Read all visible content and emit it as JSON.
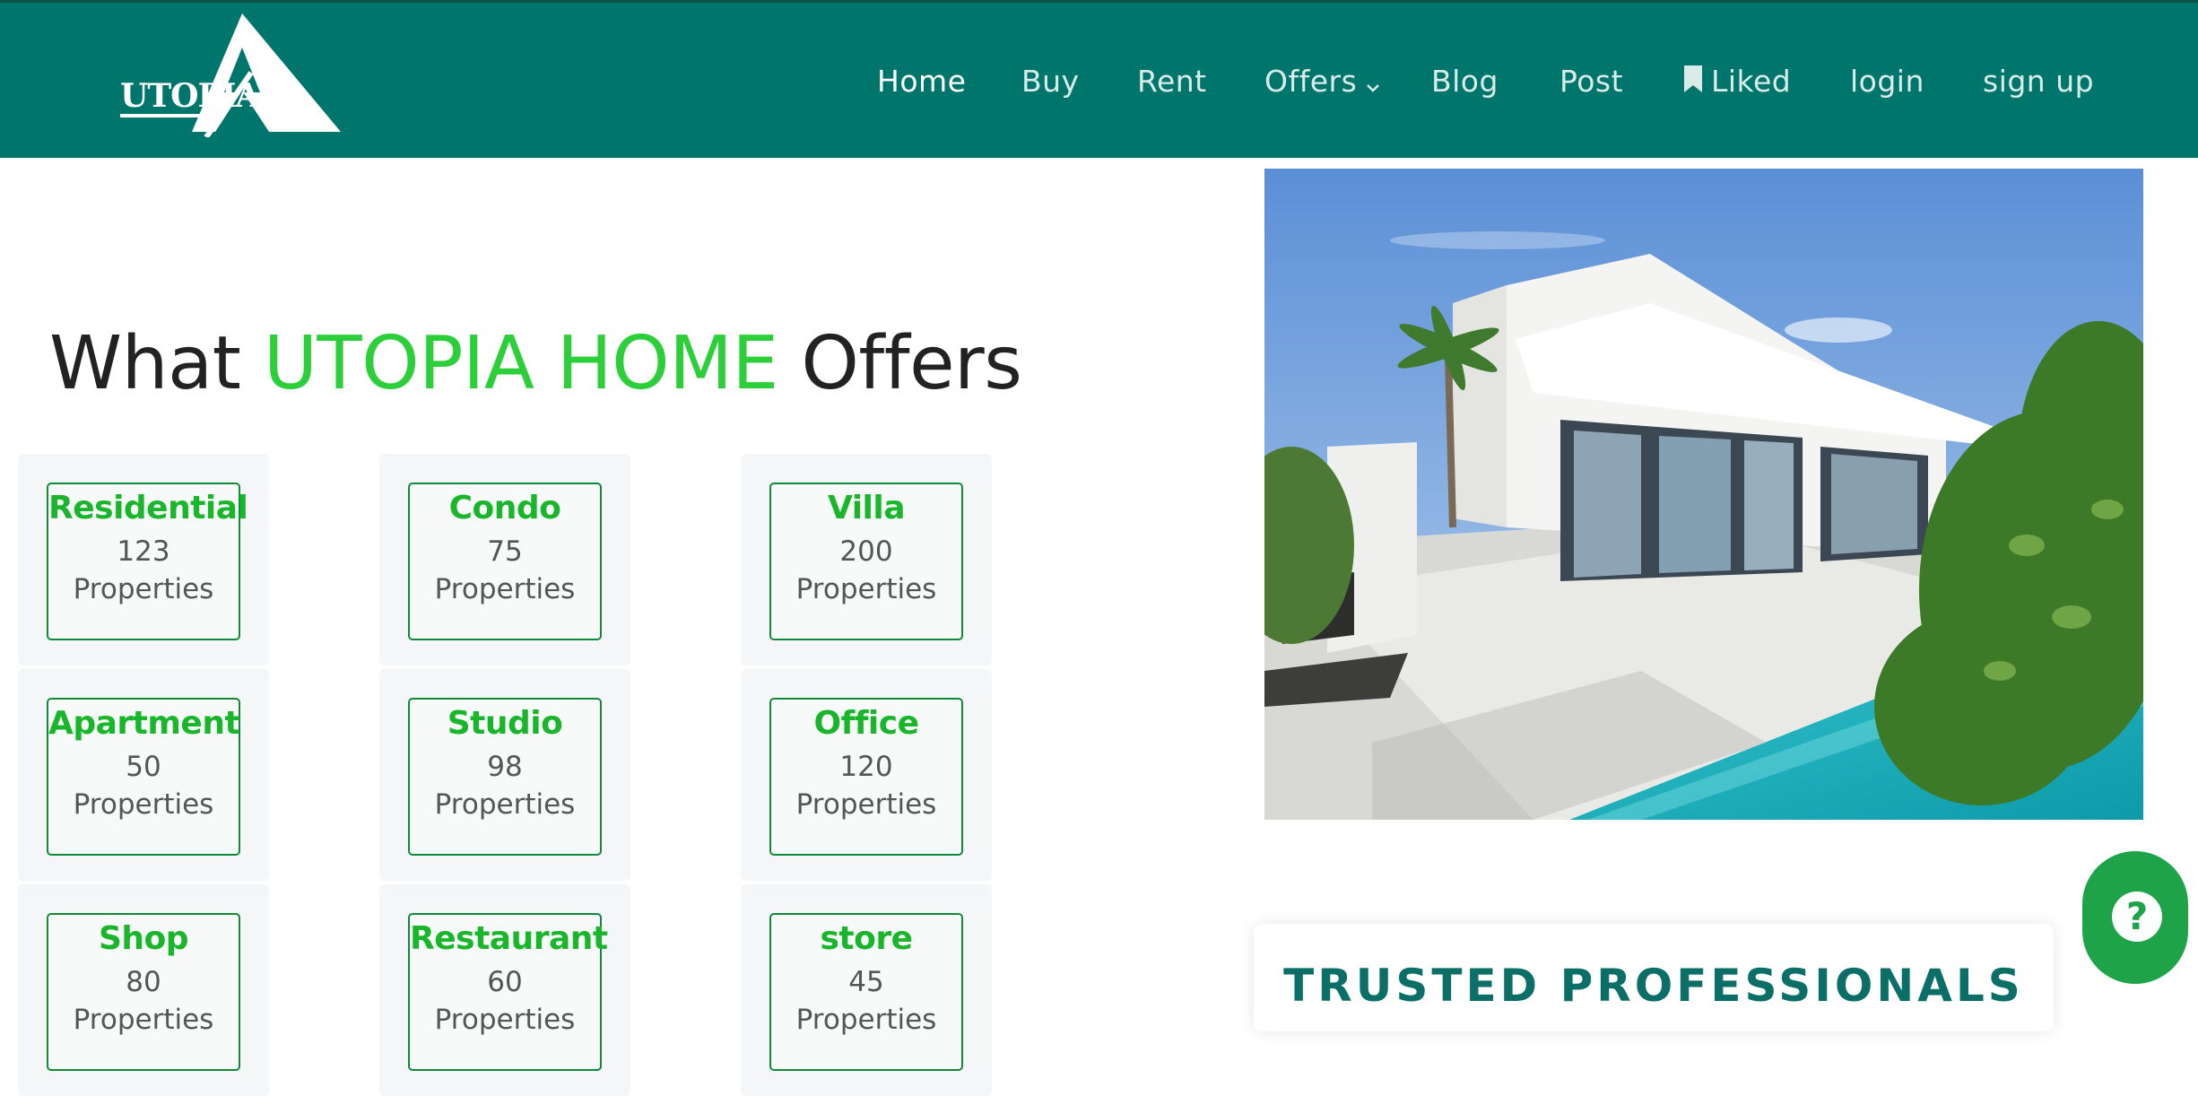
{
  "brand": {
    "logo_text": "UTOPIA",
    "colors": {
      "primary": "#00756b",
      "accent": "#2ccf3a",
      "card_title": "#19b52b",
      "help": "#1fa349"
    }
  },
  "nav": {
    "items": [
      {
        "label": "Home",
        "active": true
      },
      {
        "label": "Buy"
      },
      {
        "label": "Rent"
      },
      {
        "label": "Offers",
        "icon": "chevron-down-icon"
      },
      {
        "label": "Blog"
      },
      {
        "label": "Post"
      },
      {
        "label": "Liked",
        "icon": "bookmark-icon"
      },
      {
        "label": "login"
      },
      {
        "label": "sign up"
      }
    ]
  },
  "heading": {
    "prefix": "What",
    "highlight": "UTOPIA HOME",
    "suffix": "Offers"
  },
  "categories": [
    {
      "title": "Residential",
      "count": "123",
      "label": "Properties"
    },
    {
      "title": "Condo",
      "count": "75",
      "label": "Properties"
    },
    {
      "title": "Villa",
      "count": "200",
      "label": "Properties"
    },
    {
      "title": "Apartment",
      "count": "50",
      "label": "Properties"
    },
    {
      "title": "Studio",
      "count": "98",
      "label": "Properties"
    },
    {
      "title": "Office",
      "count": "120",
      "label": "Properties"
    },
    {
      "title": "Shop",
      "count": "80",
      "label": "Properties"
    },
    {
      "title": "Restaurant",
      "count": "60",
      "label": "Properties"
    },
    {
      "title": "store",
      "count": "45",
      "label": "Properties"
    }
  ],
  "trusted": {
    "title": "TRUSTED PROFESSIONALS"
  },
  "help": {
    "symbol": "?",
    "icon": "question-icon"
  }
}
